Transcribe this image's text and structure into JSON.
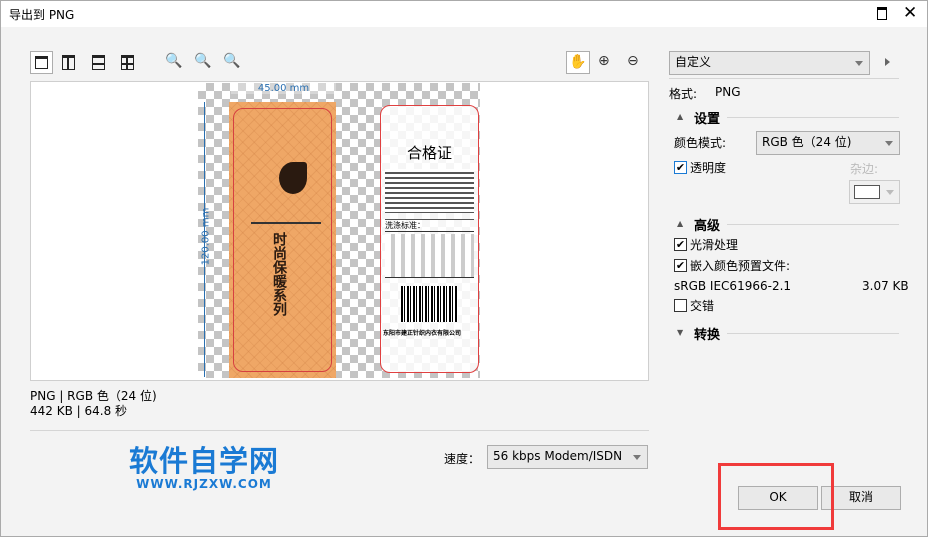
{
  "window": {
    "title": "导出到 PNG"
  },
  "toolbar": {
    "view_icons": [
      "single-view-icon",
      "split-vertical-icon",
      "split-horizontal-icon",
      "quad-view-icon"
    ],
    "zoom_icons": [
      "zoom-fit-icon",
      "zoom-1to1-icon",
      "zoom-100-icon"
    ],
    "right_icons": [
      "pan-hand-icon",
      "zoom-in-icon",
      "zoom-out-icon"
    ]
  },
  "preview": {
    "width_label": "45.00 mm",
    "height_label": "120.00 mm",
    "tag_title": "合格证",
    "brand_series": "时尚保暖系列",
    "wash_label": "洗涤标准：",
    "company": "东阳市建正针织内衣有限公司",
    "accent": "#efa766"
  },
  "info": {
    "line1": "PNG | RGB 色（24 位)",
    "line2": "442 KB | 64.8 秒"
  },
  "logo": {
    "main": "软件自学网",
    "sub": "WWW.RJZXW.COM",
    "color": "#1a7ad4"
  },
  "speed": {
    "label": "速度：",
    "value": "56 kbps Modem/ISDN"
  },
  "panel": {
    "preset": "自定义",
    "format_label": "格式:",
    "format_value": "PNG",
    "settings": {
      "title": "设置",
      "color_mode_label": "颜色模式:",
      "color_mode_value": "RGB 色（24 位)",
      "transparency": "透明度",
      "matte_label": "杂边:"
    },
    "advanced": {
      "title": "高级",
      "smoothing": "光滑处理",
      "embed_profile": "嵌入颜色预置文件:",
      "profile_name": "sRGB IEC61966-2.1",
      "profile_size": "3.07 KB",
      "interlace": "交错"
    },
    "transform": {
      "title": "转换"
    }
  },
  "buttons": {
    "ok": "OK",
    "cancel": "取消"
  }
}
